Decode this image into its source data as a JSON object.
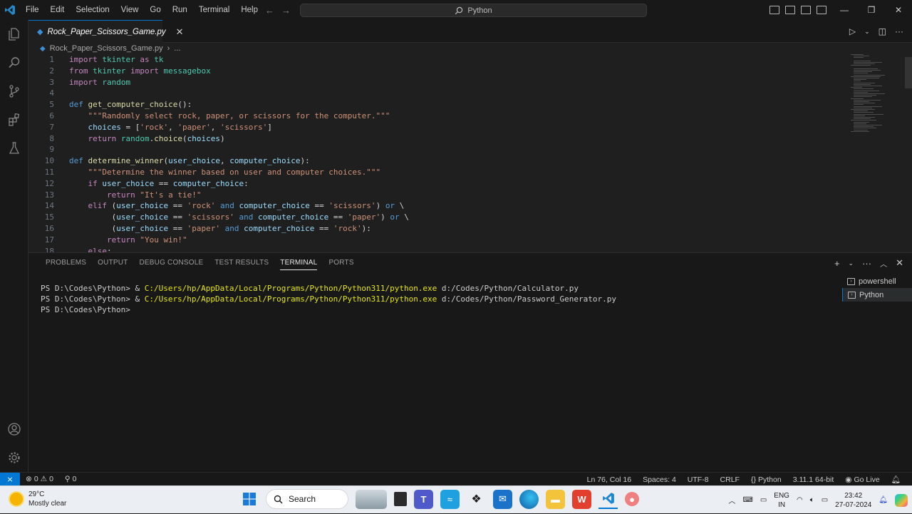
{
  "titlebar": {
    "menu": [
      "File",
      "Edit",
      "Selection",
      "View",
      "Go",
      "Run",
      "Terminal",
      "Help"
    ],
    "search": "Python"
  },
  "tab": {
    "name": "Rock_Paper_Scissors_Game.py"
  },
  "breadcrumb": {
    "file": "Rock_Paper_Scissors_Game.py",
    "more": "..."
  },
  "code_lines": [
    {
      "n": "1",
      "parts": [
        [
          "kw2",
          "import"
        ],
        [
          "op",
          " "
        ],
        [
          "mod",
          "tkinter"
        ],
        [
          "op",
          " "
        ],
        [
          "kw2",
          "as"
        ],
        [
          "op",
          " "
        ],
        [
          "mod",
          "tk"
        ]
      ]
    },
    {
      "n": "2",
      "parts": [
        [
          "kw2",
          "from"
        ],
        [
          "op",
          " "
        ],
        [
          "mod",
          "tkinter"
        ],
        [
          "op",
          " "
        ],
        [
          "kw2",
          "import"
        ],
        [
          "op",
          " "
        ],
        [
          "mod",
          "messagebox"
        ]
      ]
    },
    {
      "n": "3",
      "parts": [
        [
          "kw2",
          "import"
        ],
        [
          "op",
          " "
        ],
        [
          "mod",
          "random"
        ]
      ]
    },
    {
      "n": "4",
      "parts": []
    },
    {
      "n": "5",
      "parts": [
        [
          "kw",
          "def"
        ],
        [
          "op",
          " "
        ],
        [
          "fn",
          "get_computer_choice"
        ],
        [
          "op",
          "():"
        ]
      ]
    },
    {
      "n": "6",
      "parts": [
        [
          "op",
          "    "
        ],
        [
          "str",
          "\"\"\"Randomly select rock, paper, or scissors for the computer.\"\"\""
        ]
      ]
    },
    {
      "n": "7",
      "parts": [
        [
          "op",
          "    "
        ],
        [
          "var",
          "choices"
        ],
        [
          "op",
          " = ["
        ],
        [
          "str",
          "'rock'"
        ],
        [
          "op",
          ", "
        ],
        [
          "str",
          "'paper'"
        ],
        [
          "op",
          ", "
        ],
        [
          "str",
          "'scissors'"
        ],
        [
          "op",
          "]"
        ]
      ]
    },
    {
      "n": "8",
      "parts": [
        [
          "op",
          "    "
        ],
        [
          "kw2",
          "return"
        ],
        [
          "op",
          " "
        ],
        [
          "mod",
          "random"
        ],
        [
          "op",
          "."
        ],
        [
          "fn",
          "choice"
        ],
        [
          "op",
          "("
        ],
        [
          "var",
          "choices"
        ],
        [
          "op",
          ")"
        ]
      ]
    },
    {
      "n": "9",
      "parts": []
    },
    {
      "n": "10",
      "parts": [
        [
          "kw",
          "def"
        ],
        [
          "op",
          " "
        ],
        [
          "fn",
          "determine_winner"
        ],
        [
          "op",
          "("
        ],
        [
          "var",
          "user_choice"
        ],
        [
          "op",
          ", "
        ],
        [
          "var",
          "computer_choice"
        ],
        [
          "op",
          "):"
        ]
      ]
    },
    {
      "n": "11",
      "parts": [
        [
          "op",
          "    "
        ],
        [
          "str",
          "\"\"\"Determine the winner based on user and computer choices.\"\"\""
        ]
      ]
    },
    {
      "n": "12",
      "parts": [
        [
          "op",
          "    "
        ],
        [
          "kw2",
          "if"
        ],
        [
          "op",
          " "
        ],
        [
          "var",
          "user_choice"
        ],
        [
          "op",
          " == "
        ],
        [
          "var",
          "computer_choice"
        ],
        [
          "op",
          ":"
        ]
      ]
    },
    {
      "n": "13",
      "parts": [
        [
          "op",
          "        "
        ],
        [
          "kw2",
          "return"
        ],
        [
          "op",
          " "
        ],
        [
          "str",
          "\"It's a tie!\""
        ]
      ]
    },
    {
      "n": "14",
      "parts": [
        [
          "op",
          "    "
        ],
        [
          "kw2",
          "elif"
        ],
        [
          "op",
          " ("
        ],
        [
          "var",
          "user_choice"
        ],
        [
          "op",
          " == "
        ],
        [
          "str",
          "'rock'"
        ],
        [
          "op",
          " "
        ],
        [
          "kw",
          "and"
        ],
        [
          "op",
          " "
        ],
        [
          "var",
          "computer_choice"
        ],
        [
          "op",
          " == "
        ],
        [
          "str",
          "'scissors'"
        ],
        [
          "op",
          ") "
        ],
        [
          "kw",
          "or"
        ],
        [
          "op",
          " \\"
        ]
      ]
    },
    {
      "n": "15",
      "parts": [
        [
          "op",
          "         ("
        ],
        [
          "var",
          "user_choice"
        ],
        [
          "op",
          " == "
        ],
        [
          "str",
          "'scissors'"
        ],
        [
          "op",
          " "
        ],
        [
          "kw",
          "and"
        ],
        [
          "op",
          " "
        ],
        [
          "var",
          "computer_choice"
        ],
        [
          "op",
          " == "
        ],
        [
          "str",
          "'paper'"
        ],
        [
          "op",
          ") "
        ],
        [
          "kw",
          "or"
        ],
        [
          "op",
          " \\"
        ]
      ]
    },
    {
      "n": "16",
      "parts": [
        [
          "op",
          "         ("
        ],
        [
          "var",
          "user_choice"
        ],
        [
          "op",
          " == "
        ],
        [
          "str",
          "'paper'"
        ],
        [
          "op",
          " "
        ],
        [
          "kw",
          "and"
        ],
        [
          "op",
          " "
        ],
        [
          "var",
          "computer_choice"
        ],
        [
          "op",
          " == "
        ],
        [
          "str",
          "'rock'"
        ],
        [
          "op",
          "):"
        ]
      ]
    },
    {
      "n": "17",
      "parts": [
        [
          "op",
          "        "
        ],
        [
          "kw2",
          "return"
        ],
        [
          "op",
          " "
        ],
        [
          "str",
          "\"You win!\""
        ]
      ]
    },
    {
      "n": "18",
      "parts": [
        [
          "op",
          "    "
        ],
        [
          "kw2",
          "else"
        ],
        [
          "op",
          ":"
        ]
      ]
    }
  ],
  "panel": {
    "tabs": [
      "PROBLEMS",
      "OUTPUT",
      "DEBUG CONSOLE",
      "TEST RESULTS",
      "TERMINAL",
      "PORTS"
    ],
    "active_tab": "TERMINAL",
    "terminal_lines": [
      {
        "prompt": "PS D:\\Codes\\Python> & ",
        "path": "C:/Users/hp/AppData/Local/Programs/Python/Python311/python.exe",
        "arg": " d:/Codes/Python/Calculator.py"
      },
      {
        "prompt": "PS D:\\Codes\\Python> & ",
        "path": "C:/Users/hp/AppData/Local/Programs/Python/Python311/python.exe",
        "arg": " d:/Codes/Python/Password_Generator.py"
      },
      {
        "prompt": "PS D:\\Codes\\Python> ",
        "path": "",
        "arg": ""
      }
    ],
    "terminals": [
      "powershell",
      "Python"
    ]
  },
  "statusbar": {
    "errors": "0",
    "warnings": "0",
    "ports": "0",
    "position": "Ln 76, Col 16",
    "spaces": "Spaces: 4",
    "encoding": "UTF-8",
    "eol": "CRLF",
    "language": "Python",
    "interpreter": "3.11.1 64-bit",
    "golive": "Go Live"
  },
  "taskbar": {
    "temp": "29°C",
    "weather": "Mostly clear",
    "search": "Search",
    "lang1": "ENG",
    "lang2": "IN",
    "time": "23:42",
    "date": "27-07-2024"
  },
  "colors": {
    "accent": "#0078d4",
    "editor_bg": "#1f1f1f",
    "chrome_bg": "#181818"
  }
}
